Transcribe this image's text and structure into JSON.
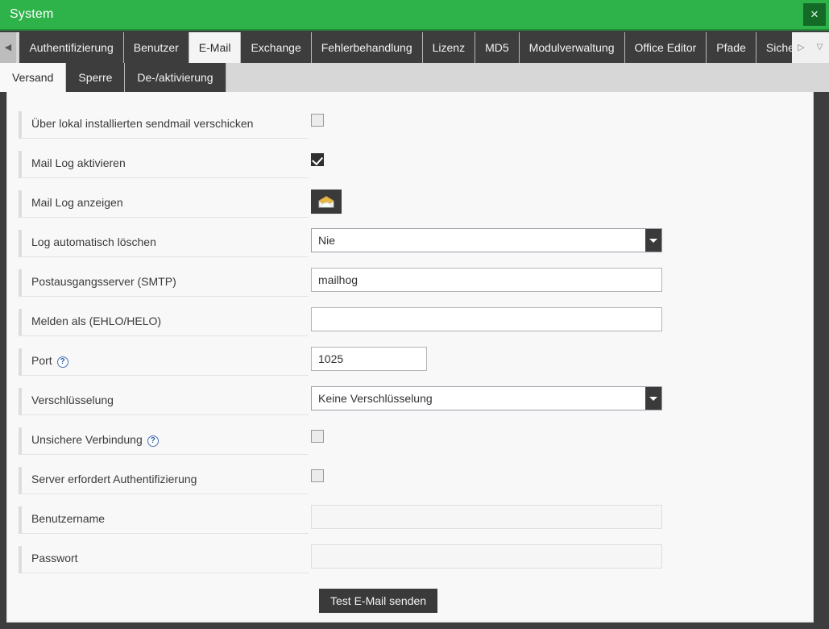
{
  "window": {
    "title": "System",
    "close_label": "×",
    "accent_color": "#2eb34a"
  },
  "tabs": {
    "scroll_left_icon": "◀",
    "scroll_right_icon": "▷",
    "dropdown_icon": "▽",
    "items": [
      {
        "label": "Authentifizierung",
        "active": false
      },
      {
        "label": "Benutzer",
        "active": false
      },
      {
        "label": "E-Mail",
        "active": true
      },
      {
        "label": "Exchange",
        "active": false
      },
      {
        "label": "Fehlerbehandlung",
        "active": false
      },
      {
        "label": "Lizenz",
        "active": false
      },
      {
        "label": "MD5",
        "active": false
      },
      {
        "label": "Modulverwaltung",
        "active": false
      },
      {
        "label": "Office Editor",
        "active": false
      },
      {
        "label": "Pfade",
        "active": false
      },
      {
        "label": "Sicherh",
        "active": false
      }
    ]
  },
  "subtabs": {
    "items": [
      {
        "label": "Versand",
        "active": true
      },
      {
        "label": "Sperre",
        "active": false
      },
      {
        "label": "De-/aktivierung",
        "active": false
      }
    ]
  },
  "form": {
    "rows": [
      {
        "label": "Über lokal installierten sendmail verschicken",
        "type": "checkbox",
        "checked": false
      },
      {
        "label": "Mail Log aktivieren",
        "type": "checkbox",
        "checked": true
      },
      {
        "label": "Mail Log anzeigen",
        "type": "icon-button",
        "icon": "envelope-icon"
      },
      {
        "label": "Log automatisch löschen",
        "type": "select",
        "value": "Nie"
      },
      {
        "label": "Postausgangsserver (SMTP)",
        "type": "text",
        "value": "mailhog",
        "size": "wide"
      },
      {
        "label": "Melden als (EHLO/HELO)",
        "type": "text",
        "value": "",
        "size": "wide"
      },
      {
        "label": "Port",
        "help": true,
        "type": "text",
        "value": "1025",
        "size": "short"
      },
      {
        "label": "Verschlüsselung",
        "type": "select",
        "value": "Keine Verschlüsselung"
      },
      {
        "label": "Unsichere Verbindung",
        "help": true,
        "type": "checkbox",
        "checked": false
      },
      {
        "label": "Server erfordert Authentifizierung",
        "type": "checkbox",
        "checked": false
      },
      {
        "label": "Benutzername",
        "type": "text",
        "value": "",
        "size": "wide",
        "disabled": true
      },
      {
        "label": "Passwort",
        "type": "text",
        "value": "",
        "size": "wide",
        "disabled": true
      }
    ],
    "help_icon_label": "?",
    "test_button_label": "Test E-Mail senden"
  }
}
